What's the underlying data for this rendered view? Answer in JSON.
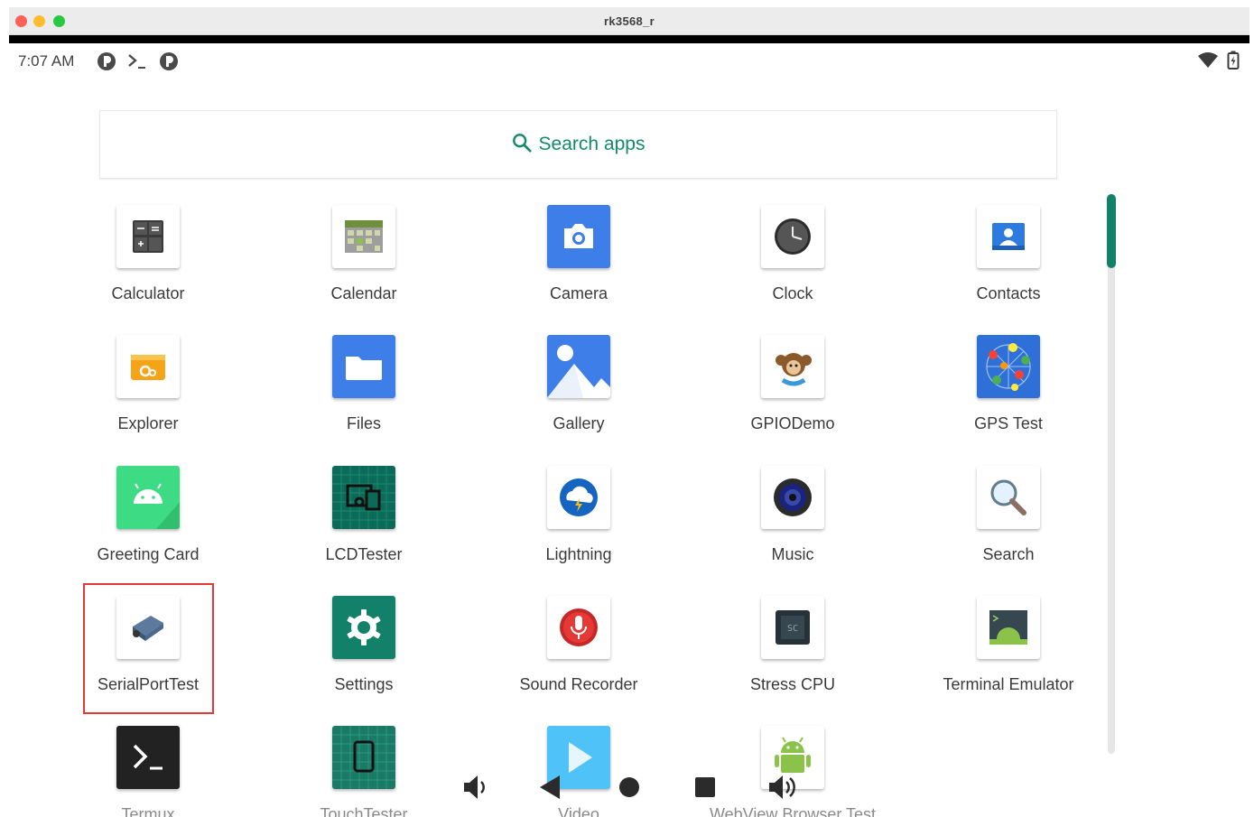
{
  "window": {
    "title": "rk3568_r"
  },
  "status_bar": {
    "time": "7:07 AM"
  },
  "search": {
    "placeholder": "Search apps"
  },
  "apps": [
    {
      "label": "Calculator"
    },
    {
      "label": "Calendar"
    },
    {
      "label": "Camera"
    },
    {
      "label": "Clock"
    },
    {
      "label": "Contacts"
    },
    {
      "label": "Explorer"
    },
    {
      "label": "Files"
    },
    {
      "label": "Gallery"
    },
    {
      "label": "GPIODemo"
    },
    {
      "label": "GPS Test"
    },
    {
      "label": "Greeting Card"
    },
    {
      "label": "LCDTester"
    },
    {
      "label": "Lightning"
    },
    {
      "label": "Music"
    },
    {
      "label": "Search"
    },
    {
      "label": "SerialPortTest"
    },
    {
      "label": "Settings"
    },
    {
      "label": "Sound Recorder"
    },
    {
      "label": "Stress CPU"
    },
    {
      "label": "Terminal Emulator"
    },
    {
      "label": "Termux"
    },
    {
      "label": "TouchTester"
    },
    {
      "label": "Video"
    },
    {
      "label": "WebView Browser Test"
    }
  ],
  "colors": {
    "accent": "#128a6e",
    "highlight": "#e53935"
  }
}
